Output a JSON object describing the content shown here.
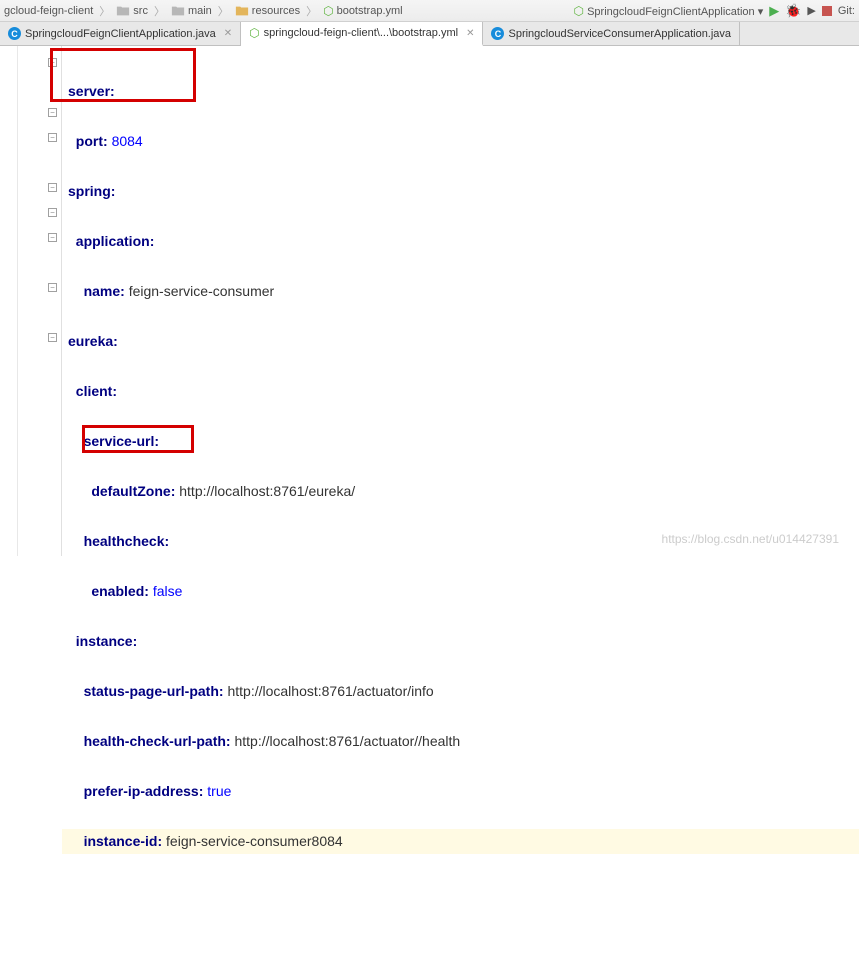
{
  "toolbar": {
    "breadcrumb": [
      {
        "icon": "module",
        "label": "gcloud-feign-client"
      },
      {
        "icon": "folder",
        "label": "src"
      },
      {
        "icon": "folder",
        "label": "main"
      },
      {
        "icon": "folder",
        "label": "resources"
      },
      {
        "icon": "yml",
        "label": "bootstrap.yml"
      }
    ],
    "run_config": "SpringcloudFeignClientApplication",
    "git_label": "Git:"
  },
  "tabs": [
    {
      "icon": "class",
      "label": "SpringcloudFeignClientApplication.java",
      "active": false
    },
    {
      "icon": "yml",
      "label": "springcloud-feign-client\\...\\bootstrap.yml",
      "active": true
    },
    {
      "icon": "class",
      "label": "SpringcloudServiceConsumerApplication.java",
      "active": false
    }
  ],
  "yaml": {
    "server_key": "server",
    "port_key": "port",
    "port_val": "8084",
    "spring_key": "spring",
    "application_key": "application",
    "name_key": "name",
    "name_val": "feign-service-consumer",
    "eureka_key": "eureka",
    "client_key": "client",
    "service_url_key": "service-url",
    "default_zone_key": "defaultZone",
    "default_zone_val": "http://localhost:8761/eureka/",
    "healthcheck_key": "healthcheck",
    "enabled_key": "enabled",
    "enabled_val": "false",
    "instance_key": "instance",
    "status_page_key": "status-page-url-path",
    "status_page_val": "http://localhost:8761/actuator/info",
    "health_check_key": "health-check-url-path",
    "health_check_val": "http://localhost:8761/actuator//health",
    "prefer_ip_key": "prefer-ip-address",
    "prefer_ip_val": "true",
    "instance_id_key": "instance-id",
    "instance_id_val": "feign-service-consumer8084"
  },
  "watermark": "https://blog.csdn.net/u014427391"
}
